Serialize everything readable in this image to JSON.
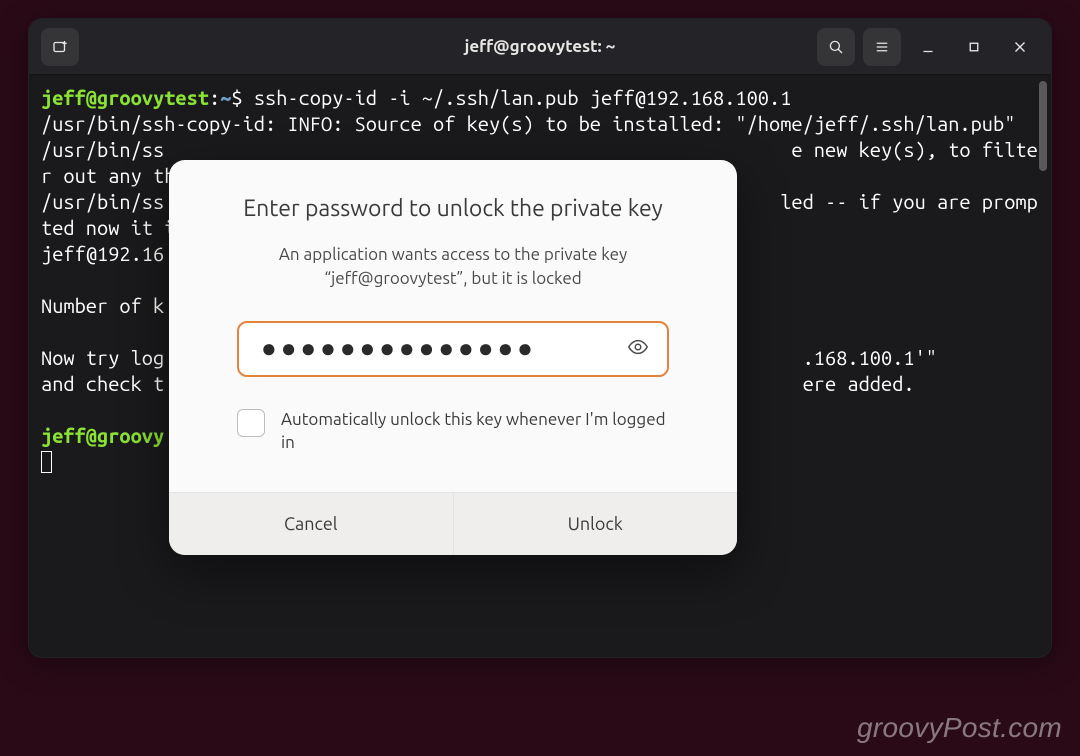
{
  "window": {
    "title": "jeff@groovytest: ~"
  },
  "terminal": {
    "prompt_user": "jeff@groovytest",
    "prompt_sep": ":",
    "prompt_path": "~",
    "prompt_dollar": "$ ",
    "command": "ssh-copy-id -i ~/.ssh/lan.pub jeff@192.168.100.1",
    "line2": "/usr/bin/ssh-copy-id: INFO: Source of key(s) to be installed: \"/home/jeff/.ssh/lan.pub\"",
    "line3a": "/usr/bin/ss",
    "line3b": "e new key(s), to filter out any tha",
    "line4a": "/usr/bin/ss",
    "line4b": "led -- if you are prompted now it i",
    "line5": "jeff@192.16",
    "blank": "",
    "line6a": "Number of k",
    "line7a": "Now try log",
    "line7b": ".168.100.1'\"",
    "line8a": "and check t",
    "line8b": "ere added.",
    "prompt2_user": "jeff@groovy"
  },
  "dialog": {
    "title": "Enter password to unlock the private key",
    "subtitle": "An application wants access to the private key “jeff@groovytest”, but it is locked",
    "password_value": "●●●●●●●●●●●●●●",
    "checkbox_label": "Automatically unlock this key whenever I'm logged in",
    "cancel_label": "Cancel",
    "unlock_label": "Unlock"
  },
  "watermark": "groovyPost.com"
}
